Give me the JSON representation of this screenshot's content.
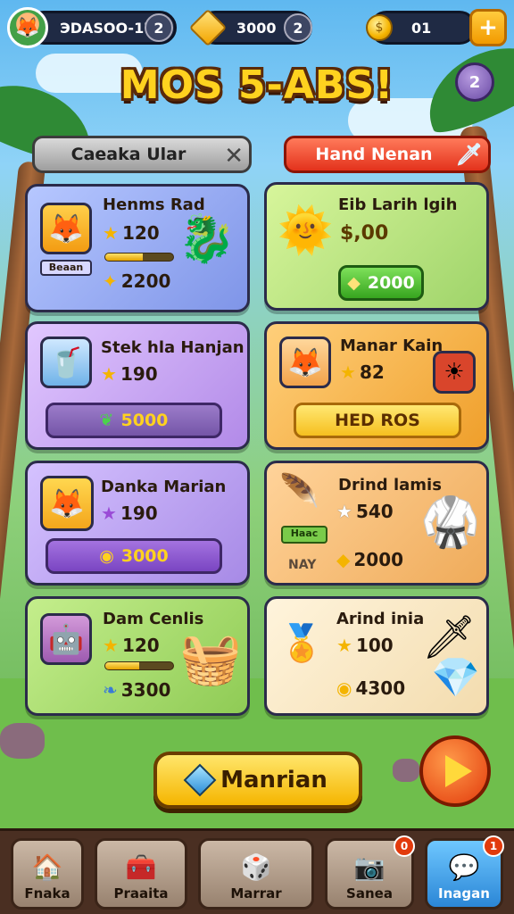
{
  "topbar": {
    "player_name": "ЭDASOO-17",
    "player_level": "2",
    "gems": "3000",
    "gems_badge": "2",
    "coins": "01",
    "plus": "+"
  },
  "title": "MOS 5-ABS!",
  "help_badge": "2",
  "tabs": {
    "left": "Caeaka Ular",
    "right": "Hand Nenan"
  },
  "cards": [
    {
      "name": "Henms Rad",
      "stat": "120",
      "price": "2200",
      "tag": "Beaan",
      "progress": 0.55
    },
    {
      "name": "Eib Larih lgih",
      "stat": "$,00",
      "price": "2000"
    },
    {
      "name": "Stek hla Hanjan",
      "stat": "190",
      "price": "5000"
    },
    {
      "name": "Manar Kain",
      "stat": "82",
      "price": "HED ROS"
    },
    {
      "name": "Danka Marian",
      "stat": "190",
      "price": "3000"
    },
    {
      "name": "Drind lamis",
      "stat": "540",
      "price": "2000",
      "tag": "Haac",
      "tag2": "NAY"
    },
    {
      "name": "Dam Cenlis",
      "stat": "120",
      "price": "3300",
      "progress": 0.5
    },
    {
      "name": "Arind inia",
      "stat": "100",
      "price": "4300"
    }
  ],
  "cta": "Manrian",
  "nav": [
    {
      "label": "Fnaka",
      "badge": ""
    },
    {
      "label": "Praaita",
      "badge": ""
    },
    {
      "label": "Marrar",
      "badge": ""
    },
    {
      "label": "Sanea",
      "badge": "0"
    },
    {
      "label": "Inagan",
      "badge": "1"
    }
  ],
  "colors": {
    "accent": "#ffd21f",
    "tab_active": "#e3321c",
    "card_blue": "#9fb3f0",
    "card_green": "#b6e37c",
    "card_purple": "#cdaef0",
    "card_orange": "#f6b24c"
  },
  "icons": {
    "avatar": "fox-avatar-icon",
    "gem": "gold-gem-icon",
    "coin": "coin-icon",
    "close": "close-icon",
    "sword": "sword-icon",
    "star": "star-icon",
    "play": "play-icon"
  }
}
